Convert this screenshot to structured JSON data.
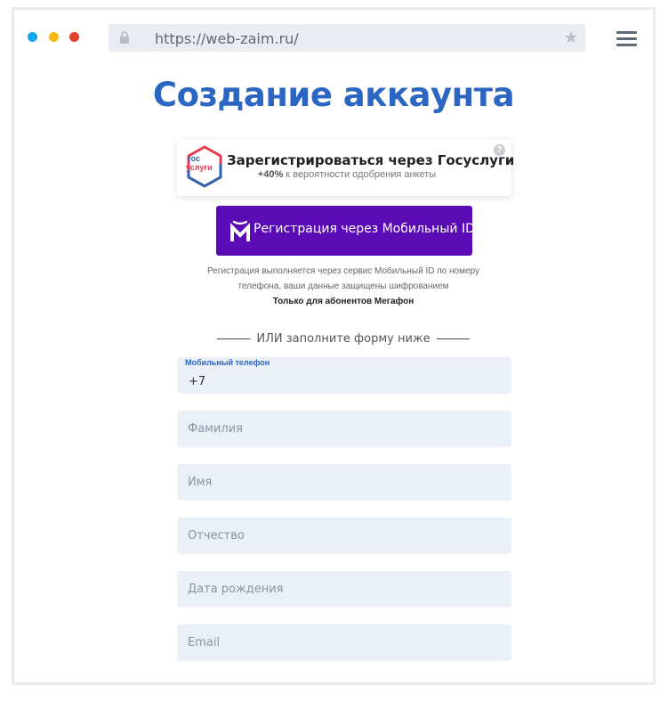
{
  "browser": {
    "url": "https://web-zaim.ru/",
    "dots": [
      "#12a8ec",
      "#f6b710",
      "#e0432d"
    ]
  },
  "page": {
    "title": "Создание аккаунта"
  },
  "gosuslugi": {
    "logo_top": "гос",
    "logo_bottom": "услуги",
    "title": "Зарегистрироваться через Госуслуги",
    "sub_bold": "+40%",
    "sub_rest": " к вероятности одобрения анкеты",
    "help": "?"
  },
  "mobile_id": {
    "label": "Регистрация через Мобильный ID",
    "color": "#5a0bb5",
    "note_line1": "Регистрация выполняется через сервис Мобильный ID по номеру",
    "note_line2": "телефона, ваши данные защищены шифрованием",
    "note_bold": "Только для абонентов Мегафон"
  },
  "divider": {
    "text": "ИЛИ заполните форму ниже"
  },
  "form": {
    "phone_label": "Мобильный телефон",
    "phone_value": "+7",
    "surname_placeholder": "Фамилия",
    "name_placeholder": "Имя",
    "patronymic_placeholder": "Отчество",
    "birthdate_placeholder": "Дата рождения",
    "email_placeholder": "Email"
  },
  "colors": {
    "title": "#2c66c3",
    "field_bg": "#ebeff6"
  }
}
